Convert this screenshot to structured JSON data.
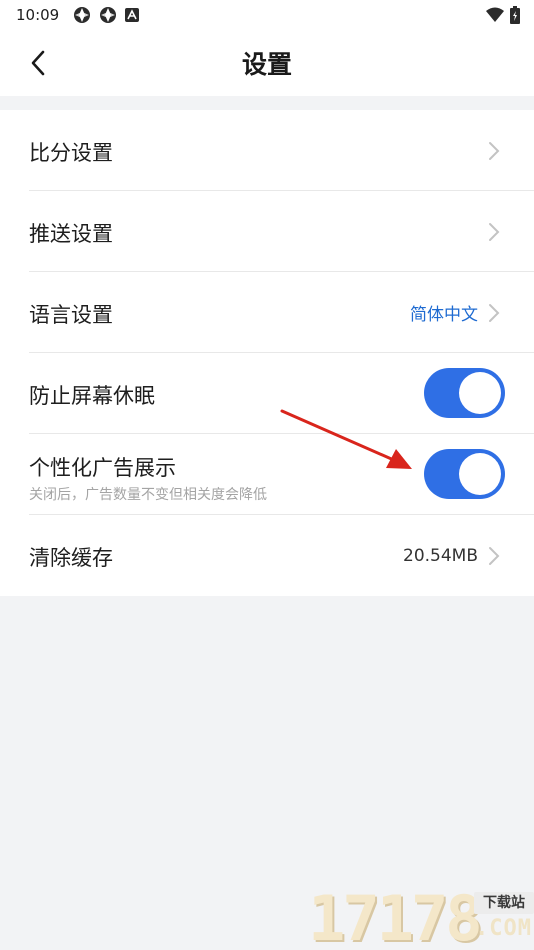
{
  "status_bar": {
    "time": "10:09",
    "icons": [
      "aperture-icon",
      "aperture-icon",
      "a-icon"
    ],
    "right_icons": [
      "wifi-icon",
      "battery-charging-icon"
    ]
  },
  "header": {
    "title": "设置",
    "back_icon": "chevron-left-icon"
  },
  "settings": {
    "score": {
      "label": "比分设置"
    },
    "push": {
      "label": "推送设置"
    },
    "language": {
      "label": "语言设置",
      "value": "简体中文"
    },
    "keep_awake": {
      "label": "防止屏幕休眠",
      "enabled": true
    },
    "personalized_ads": {
      "label": "个性化广告展示",
      "subtitle": "关闭后，广告数量不变但相关度会降低",
      "enabled": true
    },
    "clear_cache": {
      "label": "清除缓存",
      "value": "20.54MB"
    }
  },
  "colors": {
    "accent": "#2f6fe5",
    "link": "#1f6bd1",
    "background": "#f2f3f5",
    "arrow": "#d9251c"
  },
  "watermark": {
    "digits": "17178",
    "badge": "下载站",
    "suffix": ".COM"
  }
}
